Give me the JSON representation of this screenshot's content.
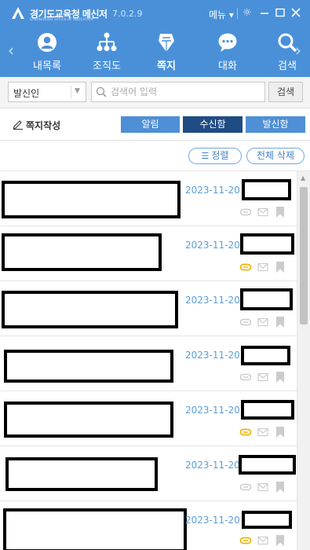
{
  "app": {
    "name": "경기도교육청 메신저",
    "subname": "GYEONGGIDO OFFICE OF EDUCATION",
    "version": "7.0.2.9",
    "menu_label": "메뉴 ▾"
  },
  "nav": {
    "items": [
      {
        "label": "내목록",
        "icon": "user-icon"
      },
      {
        "label": "조직도",
        "icon": "org-chart-icon"
      },
      {
        "label": "쪽지",
        "icon": "note-icon",
        "active": true
      },
      {
        "label": "대화",
        "icon": "chat-icon"
      },
      {
        "label": "검색",
        "icon": "search-icon"
      }
    ]
  },
  "search": {
    "sender_value": "발신인",
    "placeholder": "검색어 입력",
    "button_label": "검색"
  },
  "toolbar": {
    "compose_label": "쪽지작성",
    "tabs": [
      {
        "label": "알림",
        "active": false
      },
      {
        "label": "수신함",
        "active": true
      },
      {
        "label": "발신함",
        "active": false
      }
    ]
  },
  "sortbar": {
    "sort_label": "정렬",
    "delete_all_label": "전체 삭제"
  },
  "messages": [
    {
      "date": "2023-11-20",
      "subject": "[redacted]",
      "sender": "[redacted]",
      "attachment_active": false
    },
    {
      "date": "2023-11-20",
      "subject": "[redacted]",
      "sender": "[redacted]",
      "attachment_active": true
    },
    {
      "date": "2023-11-20",
      "subject": "[redacted]",
      "sender": "[redacted]",
      "attachment_active": false
    },
    {
      "date": "2023-11-20",
      "subject": "[redacted]",
      "sender": "[redacted]",
      "attachment_active": false
    },
    {
      "date": "2023-11-20",
      "subject": "[redacted]",
      "sender": "[redacted]",
      "attachment_active": true
    },
    {
      "date": "2023-11-20",
      "subject": "[redacted]",
      "sender": "[redacted]",
      "attachment_active": false
    },
    {
      "date": "2023-11-20",
      "subject": "[redacted]",
      "sender": "[redacted]",
      "attachment_active": true
    }
  ],
  "colors": {
    "header": "#4a90d9",
    "tab_active": "#1f4c84",
    "tab_inactive": "#4e8fd6",
    "date_text": "#5b9fd8",
    "attachment_active": "#f0b400"
  }
}
